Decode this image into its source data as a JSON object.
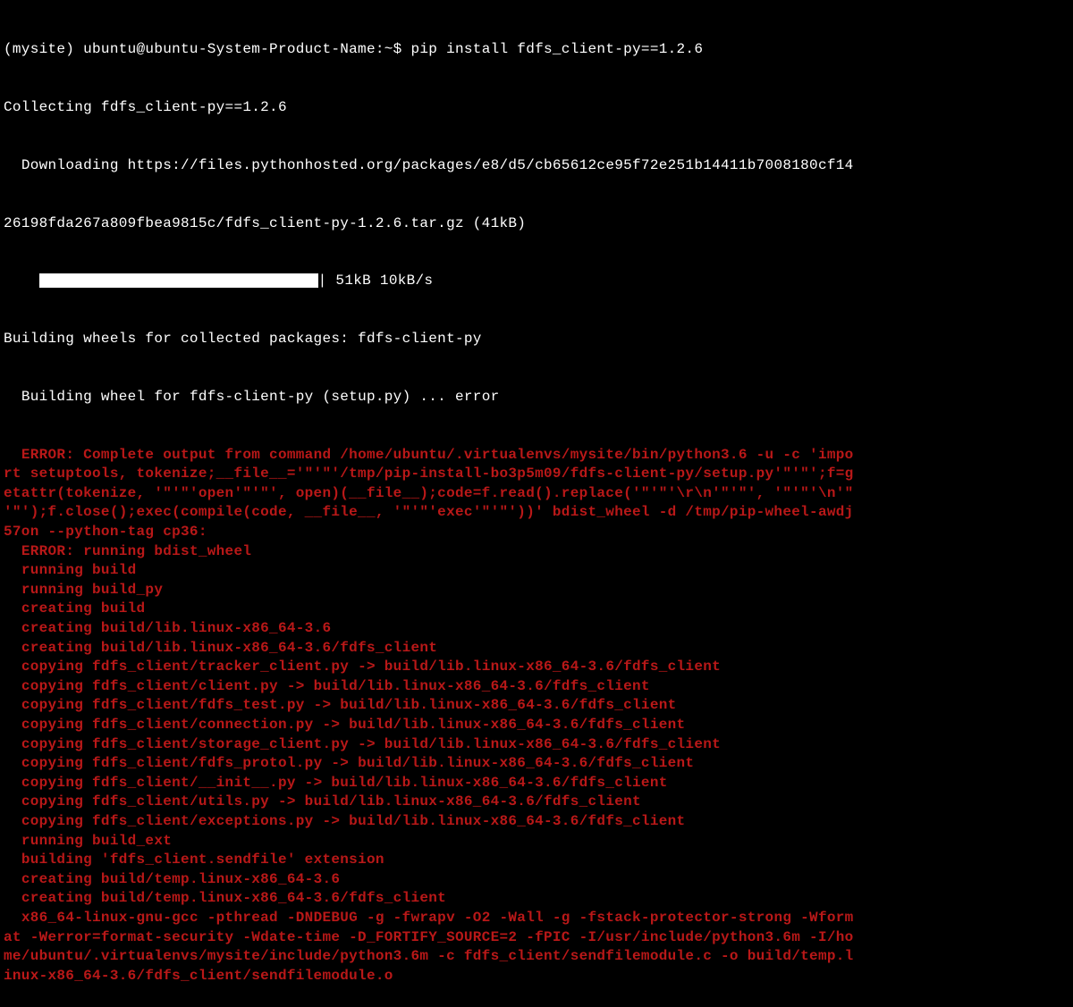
{
  "prompt": "(mysite) ubuntu@ubuntu-System-Product-Name:~$ ",
  "command": "pip install fdfs_client-py==1.2.6",
  "lines": {
    "collecting": "Collecting fdfs_client-py==1.2.6",
    "downloading1": "  Downloading https://files.pythonhosted.org/packages/e8/d5/cb65612ce95f72e251b14411b7008180cf14",
    "downloading2": "26198fda267a809fbea9815c/fdfs_client-py-1.2.6.tar.gz (41kB)",
    "progress_prefix": "    ",
    "progress_suffix": "| 51kB 10kB/s",
    "building_wheels": "Building wheels for collected packages: fdfs-client-py",
    "building_wheel_for": "  Building wheel for fdfs-client-py (setup.py) ... error"
  },
  "error_lines": [
    "  ERROR: Complete output from command /home/ubuntu/.virtualenvs/mysite/bin/python3.6 -u -c 'impo",
    "rt setuptools, tokenize;__file__='\"'\"'/tmp/pip-install-bo3p5m09/fdfs-client-py/setup.py'\"'\"';f=g",
    "etattr(tokenize, '\"'\"'open'\"'\"', open)(__file__);code=f.read().replace('\"'\"'\\r\\n'\"'\"', '\"'\"'\\n'\"",
    "'\"');f.close();exec(compile(code, __file__, '\"'\"'exec'\"'\"'))' bdist_wheel -d /tmp/pip-wheel-awdj",
    "57on --python-tag cp36:",
    "  ERROR: running bdist_wheel",
    "  running build",
    "  running build_py",
    "  creating build",
    "  creating build/lib.linux-x86_64-3.6",
    "  creating build/lib.linux-x86_64-3.6/fdfs_client",
    "  copying fdfs_client/tracker_client.py -> build/lib.linux-x86_64-3.6/fdfs_client",
    "  copying fdfs_client/client.py -> build/lib.linux-x86_64-3.6/fdfs_client",
    "  copying fdfs_client/fdfs_test.py -> build/lib.linux-x86_64-3.6/fdfs_client",
    "  copying fdfs_client/connection.py -> build/lib.linux-x86_64-3.6/fdfs_client",
    "  copying fdfs_client/storage_client.py -> build/lib.linux-x86_64-3.6/fdfs_client",
    "  copying fdfs_client/fdfs_protol.py -> build/lib.linux-x86_64-3.6/fdfs_client",
    "  copying fdfs_client/__init__.py -> build/lib.linux-x86_64-3.6/fdfs_client",
    "  copying fdfs_client/utils.py -> build/lib.linux-x86_64-3.6/fdfs_client",
    "  copying fdfs_client/exceptions.py -> build/lib.linux-x86_64-3.6/fdfs_client",
    "  running build_ext",
    "  building 'fdfs_client.sendfile' extension",
    "  creating build/temp.linux-x86_64-3.6",
    "  creating build/temp.linux-x86_64-3.6/fdfs_client",
    "  x86_64-linux-gnu-gcc -pthread -DNDEBUG -g -fwrapv -O2 -Wall -g -fstack-protector-strong -Wform",
    "at -Werror=format-security -Wdate-time -D_FORTIFY_SOURCE=2 -fPIC -I/usr/include/python3.6m -I/ho",
    "me/ubuntu/.virtualenvs/mysite/include/python3.6m -c fdfs_client/sendfilemodule.c -o build/temp.l",
    "inux-x86_64-3.6/fdfs_client/sendfilemodule.o"
  ]
}
